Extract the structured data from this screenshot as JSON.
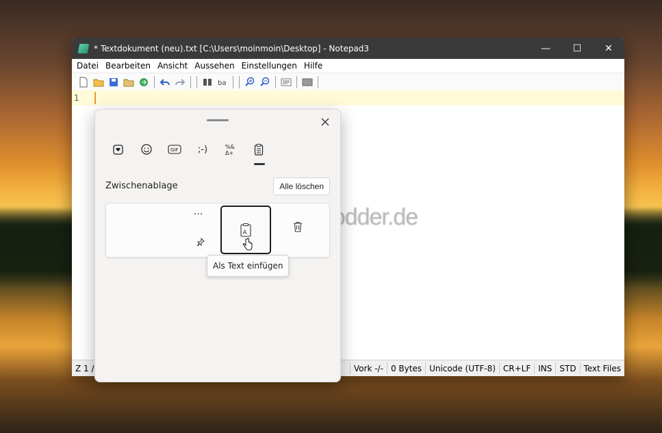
{
  "window": {
    "title": "* Textdokument (neu).txt [C:\\Users\\moinmoin\\Desktop] - Notepad3",
    "controls": {
      "minimize": "—",
      "maximize": "☐",
      "close": "✕"
    }
  },
  "menu": [
    "Datei",
    "Bearbeiten",
    "Ansicht",
    "Aussehen",
    "Einstellungen",
    "Hilfe"
  ],
  "editor": {
    "line_number": "1"
  },
  "statusbar": {
    "position": "Z  1 /",
    "dashes": "--",
    "mode": "Vork  -/-",
    "size": "0 Bytes",
    "encoding": "Unicode (UTF-8)",
    "eol": "CR+LF",
    "ins": "INS",
    "std": "STD",
    "filetype": "Text Files"
  },
  "clipboard": {
    "tabs": [
      {
        "icon": "sticker-icon",
        "glyph": "♥"
      },
      {
        "icon": "emoji-icon",
        "glyph": "☺"
      },
      {
        "icon": "gif-icon",
        "glyph": "GIF"
      },
      {
        "icon": "kaomoji-icon",
        "glyph": ";-)"
      },
      {
        "icon": "symbols-icon",
        "glyph": "%&"
      },
      {
        "icon": "clipboard-icon",
        "glyph": "📋"
      }
    ],
    "section_title": "Zwischenablage",
    "clear_all_label": "Alle löschen",
    "tooltip": "Als Text einfügen",
    "more_glyph": "···"
  },
  "watermark": "Deskmodder.de"
}
